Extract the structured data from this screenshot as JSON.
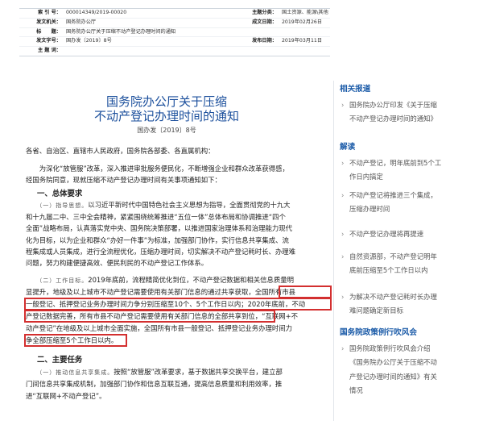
{
  "meta": {
    "rows": [
      {
        "k1": "索 引 号：",
        "v1": "000014349/2019-00020",
        "k2": "主题分类：",
        "v2": "国土资源、能源\\其他"
      },
      {
        "k1": "发文机关：",
        "v1": "国务院办公厅",
        "k2": "成文日期：",
        "v2": "2019年02月26日"
      },
      {
        "k1": "标　　题：",
        "v1": "国务院办公厅关于压缩不动产登记办理时间的通知",
        "k2": "",
        "v2": ""
      },
      {
        "k1": "发文字号：",
        "v1": "国办发〔2019〕8号",
        "k2": "发布日期：",
        "v2": "2019年03月11日"
      },
      {
        "k1": "主 题 词：",
        "v1": "",
        "k2": "",
        "v2": ""
      }
    ]
  },
  "doc": {
    "title_line1": "国务院办公厅关于压缩",
    "title_line2": "不动产登记办理时间的通知",
    "docno": "国办发〔2019〕8号",
    "salutation": "各省、自治区、直辖市人民政府，国务院各部委、各直属机构：",
    "intro_l1": "　　为深化“放管服”改革，深入推进审批服务便民化，不断增强企业和群众改革获得感，",
    "intro_l2": "经国务院同意，现就压缩不动产登记办理时间有关事项通知如下：",
    "sec1": "一、总体要求",
    "p1_lead": "（一）指导思想。",
    "p1_l1": "以习近平新时代中国特色社会主义思想为指导，全面贯彻党的十九大",
    "p1_l2": "和十九届二中、三中全会精神，紧紧围绕统筹推进“五位一体”总体布局和协调推进“四个",
    "p1_l3": "全面”战略布局，认真落实党中央、国务院决策部署，以推进国家治理体系和治理能力现代",
    "p1_l4": "化为目标，以为企业和群众“办好一件事”为标准，加强部门协作，实行信息共享集成、流",
    "p1_l5": "程集成或人员集成，进行全流程优化，压缩办理时间，切实解决不动产登记耗时长、办理难",
    "p1_l6": "问题，努力构建便捷高效、便民利民的不动产登记工作体系。",
    "p2_lead": "（二）工作目标。",
    "p2_l1": "2019年底前，流程精简优化到位，不动产登记数据和相关信息质量明",
    "p2_l2": "显提升，地级及以上城市不动产登记需要使用有关部门信息的通过共享获取，全国所有市县",
    "p2_l3": "一般登记、抵押登记业务办理时间力争分别压缩至10个、5个工作日以内；2020年底前，不动",
    "p2_l4": "产登记数据完善，所有市县不动产登记需要使用有关部门信息的全部共享到位，“互联网+不",
    "p2_l5": "动产登记”在地级及以上城市全面实施，全国所有市县一般登记、抵押登记业务办理时间力",
    "p2_l6": "争全部压缩至5个工作日以内。",
    "sec2": "二、主要任务",
    "p3_lead": "（一）推动信息共享集成。",
    "p3_l1": "按照“放管服”改革要求，基于数据共享交换平台，建立部",
    "p3_l2": "门间信息共享集成机制，加强部门协作和信息互联互通，提高信息质量和利用效率，推",
    "p3_l3": "进“互联网+不动产登记”。"
  },
  "side": {
    "h1": "相关报道",
    "r1_l1": "国务院办公厅印发《关于压缩",
    "r1_l2": "不动产登记办理时间的通知》",
    "h2": "解读",
    "j1_l1": "不动产登记，明年底前到5个工",
    "j1_l2": "作日内搞定",
    "j2_l1": "不动产登记将推进三个集成，",
    "j2_l2": "压缩办理时间",
    "j3_l1": "不动产登记办理将再提速",
    "j4_l1": "自然资源部，不动产登记明年",
    "j4_l2": "底前压缩至5个工作日以内",
    "j5_l1": "为解决不动产登记耗时长办理",
    "j5_l2": "难问题确定新目标",
    "h3": "国务院政策例行吹风会",
    "c1_l1": "国务院政策例行吹风会介绍",
    "c1_l2": "《国务院办公厅关于压缩不动",
    "c1_l3": "产登记办理时间的通知》有关",
    "c1_l4": "情况"
  }
}
